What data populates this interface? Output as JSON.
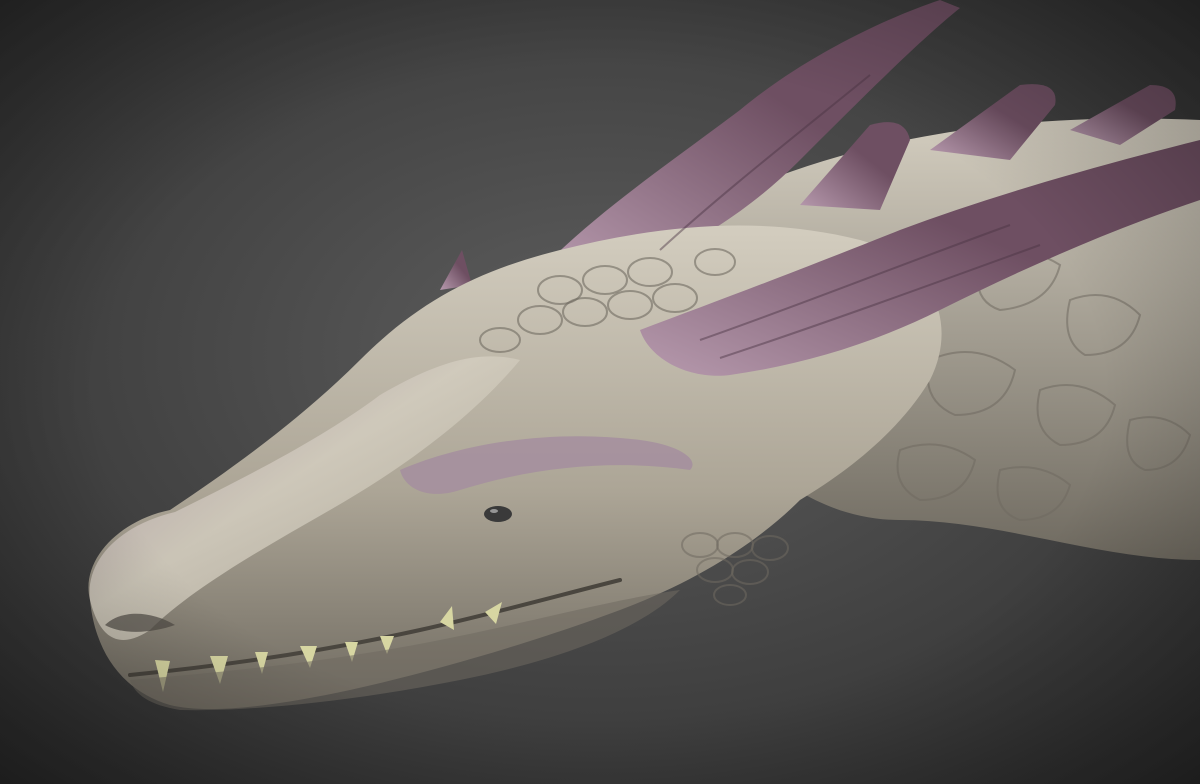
{
  "scene": {
    "subject": "dragon-head-sculpt",
    "palette": {
      "background_center": "#5e5e5e",
      "background_edge": "#2c2c2c",
      "skin_light": "#d3cdbf",
      "skin_mid": "#aca596",
      "skin_shadow": "#6f6a60",
      "skin_purple": "#a58e9f",
      "horn_dark": "#6e4f62",
      "horn_light": "#b79aae",
      "eye": "#3a3a3a",
      "teeth": "#d7d6a2"
    }
  }
}
